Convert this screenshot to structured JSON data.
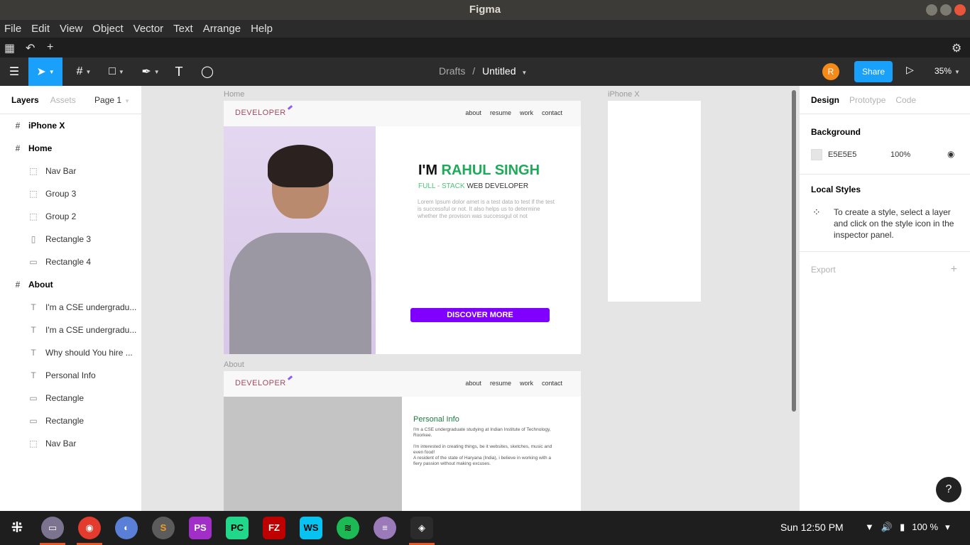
{
  "window": {
    "title": "Figma"
  },
  "menu": [
    "File",
    "Edit",
    "View",
    "Object",
    "Vector",
    "Text",
    "Arrange",
    "Help"
  ],
  "toolbar": {
    "breadcrumb_drafts": "Drafts",
    "separator": "/",
    "file_name": "Untitled",
    "avatar_letter": "R",
    "share_label": "Share",
    "zoom": "35%"
  },
  "left_panel": {
    "tabs": [
      "Layers",
      "Assets"
    ],
    "page": "Page 1",
    "layers": [
      {
        "name": "iPhone X",
        "icon": "#",
        "level": 0
      },
      {
        "name": "Home",
        "icon": "#",
        "level": 0
      },
      {
        "name": "Nav Bar",
        "icon": "⬚",
        "level": 1
      },
      {
        "name": "Group 3",
        "icon": "⬚",
        "level": 1
      },
      {
        "name": "Group 2",
        "icon": "⬚",
        "level": 1
      },
      {
        "name": "Rectangle 3",
        "icon": "▯",
        "level": 1
      },
      {
        "name": "Rectangle 4",
        "icon": "▭",
        "level": 1
      },
      {
        "name": "About",
        "icon": "#",
        "level": 0
      },
      {
        "name": "I'm a CSE undergradu...",
        "icon": "T",
        "level": 1
      },
      {
        "name": "I'm a CSE undergradu...",
        "icon": "T",
        "level": 1
      },
      {
        "name": "Why should You hire ...",
        "icon": "T",
        "level": 1
      },
      {
        "name": "Personal Info",
        "icon": "T",
        "level": 1
      },
      {
        "name": "Rectangle",
        "icon": "▭",
        "level": 1
      },
      {
        "name": "Rectangle",
        "icon": "▭",
        "level": 1
      },
      {
        "name": "Nav Bar",
        "icon": "⬚",
        "level": 1
      }
    ]
  },
  "canvas": {
    "home": {
      "label": "Home",
      "logo": "DEVELOPER",
      "nav": [
        "about",
        "resume",
        "work",
        "contact"
      ],
      "headline_prefix": "I'M ",
      "headline_name": "RAHUL SINGH",
      "sub_accent": "FULL - STACK",
      "sub_rest": " WEB DEVELOPER",
      "lorem": "Lorem Ipsum dolor amet is a test data to test if the test is successful or not. It also helps us to determine whether the provison was successgul ot not",
      "button": "DISCOVER MORE"
    },
    "iphone": {
      "label": "iPhone X"
    },
    "about": {
      "label": "About",
      "logo": "DEVELOPER",
      "nav": [
        "about",
        "resume",
        "work",
        "contact"
      ],
      "title": "Personal Info",
      "p1": "I'm a CSE undergraduate studying at Indian Institute of Technology, Roorkee.",
      "p2": "I'm interested in creating things, be it websites, sketches, music and even food!",
      "p3": "A resident of the state of Haryana (India), i believe in working with a fiery passion without making excuses."
    }
  },
  "right_panel": {
    "tabs": [
      "Design",
      "Prototype",
      "Code"
    ],
    "background_title": "Background",
    "bg_hex": "E5E5E5",
    "bg_opacity": "100%",
    "local_styles_title": "Local Styles",
    "local_styles_text": "To create a style, select a layer and click on the style icon in the inspector panel.",
    "export_label": "Export"
  },
  "taskbar": {
    "time": "Sun 12:50 PM",
    "battery": "100 %",
    "apps": [
      "apps-grid",
      "files",
      "chrome",
      "firefox",
      "sublime",
      "phpstorm",
      "pycharm",
      "filezilla",
      "webstorm",
      "spotify",
      "text-editor",
      "figma"
    ]
  },
  "colors": {
    "accent": "#18a0fb",
    "brand_green": "#1faa59",
    "cta_purple": "#8000ff"
  }
}
